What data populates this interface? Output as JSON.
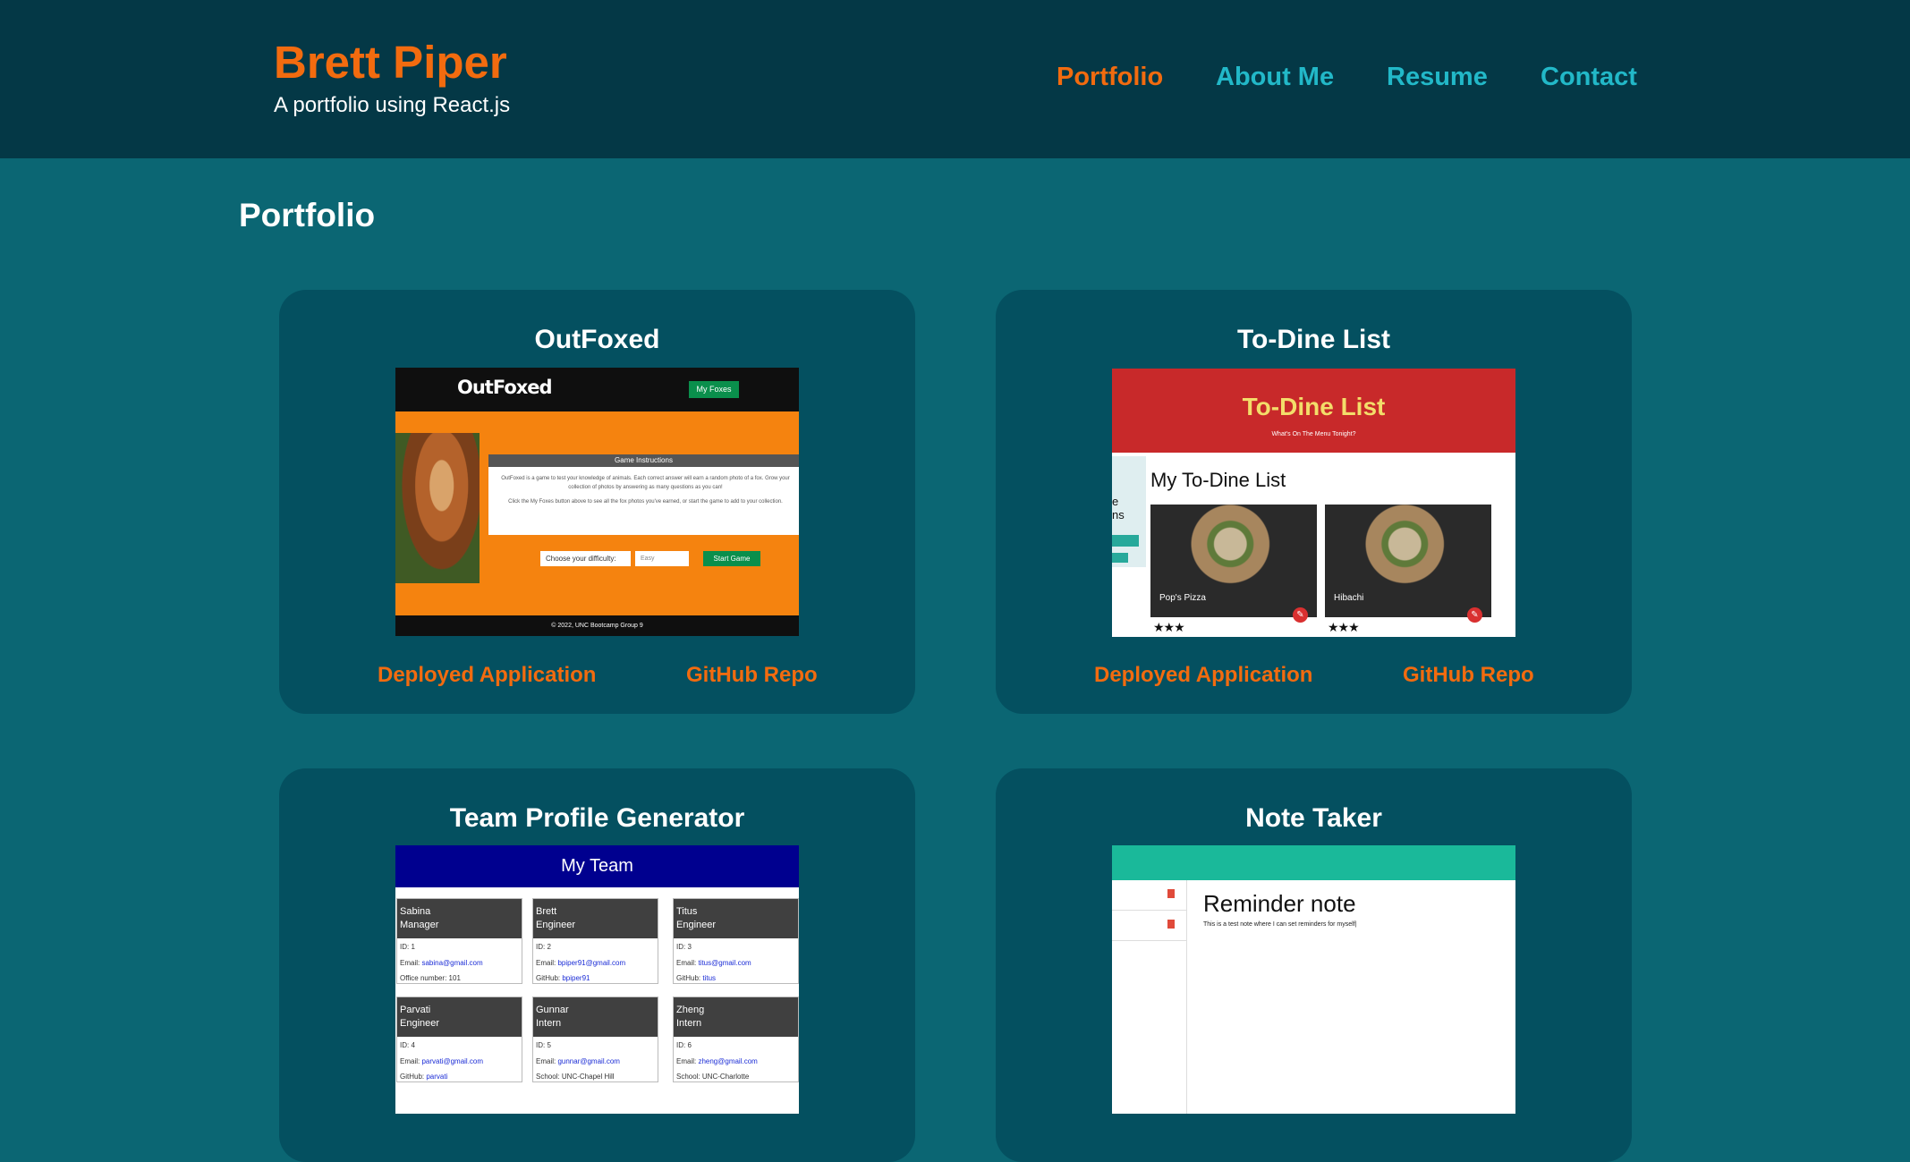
{
  "header": {
    "name": "Brett Piper",
    "tagline": "A portfolio using React.js",
    "nav": [
      {
        "label": "Portfolio",
        "active": true
      },
      {
        "label": "About Me"
      },
      {
        "label": "Resume"
      },
      {
        "label": "Contact"
      }
    ]
  },
  "page": {
    "title": "Portfolio"
  },
  "projects": [
    {
      "title": "OutFoxed",
      "deployed_label": "Deployed Application",
      "repo_label": "GitHub Repo",
      "screenshot": {
        "logo": "OutFoxed",
        "button": "My Foxes",
        "panel_title": "Game Instructions",
        "panel_text_1": "OutFoxed is a game to test your knowledge of animals. Each correct answer will earn a random photo of a fox. Grow your collection of photos by answering as many questions as you can!",
        "panel_text_2": "Click the My Foxes button above to see all the fox photos you've earned, or start the game to add to your collection.",
        "difficulty_label": "Choose your difficulty:",
        "difficulty_value": "Easy",
        "start_button": "Start Game",
        "footer": "© 2022, UNC Bootcamp Group 9"
      }
    },
    {
      "title": "To-Dine List",
      "deployed_label": "Deployed Application",
      "repo_label": "GitHub Repo",
      "screenshot": {
        "logo": "To-Dine List",
        "tagline": "What's On The Menu Tonight?",
        "side_text": "e\nns",
        "heading": "My To-Dine List",
        "cards": [
          {
            "label": "Pop's Pizza",
            "stars": "★★★"
          },
          {
            "label": "Hibachi",
            "stars": "★★★"
          }
        ]
      }
    },
    {
      "title": "Team Profile Generator",
      "screenshot": {
        "header": "My Team",
        "members": [
          {
            "name": "Sabina",
            "role": "Manager",
            "id": "ID: 1",
            "email": "sabina@gmail.com",
            "extra_label": "Office number: ",
            "extra_value": "101"
          },
          {
            "name": "Brett",
            "role": "Engineer",
            "id": "ID: 2",
            "email": "bpiper91@gmail.com",
            "extra_label": "GitHub: ",
            "extra_value": "bpiper91"
          },
          {
            "name": "Titus",
            "role": "Engineer",
            "id": "ID: 3",
            "email": "titus@gmail.com",
            "extra_label": "GitHub: ",
            "extra_value": "titus"
          },
          {
            "name": "Parvati",
            "role": "Engineer",
            "id": "ID: 4",
            "email": "parvati@gmail.com",
            "extra_label": "GitHub: ",
            "extra_value": "parvati"
          },
          {
            "name": "Gunnar",
            "role": "Intern",
            "id": "ID: 5",
            "email": "gunnar@gmail.com",
            "extra_label": "School: ",
            "extra_value": "UNC-Chapel Hill"
          },
          {
            "name": "Zheng",
            "role": "Intern",
            "id": "ID: 6",
            "email": "zheng@gmail.com",
            "extra_label": "School: ",
            "extra_value": "UNC-Charlotte"
          }
        ]
      }
    },
    {
      "title": "Note Taker",
      "screenshot": {
        "note_title": "Reminder note",
        "note_text": "This is a test note where I can set reminders for myself|"
      }
    }
  ],
  "colors": {
    "page_bg": "#0b6673",
    "header_bg": "#043846",
    "card_bg": "#045060",
    "accent": "#f26b0f",
    "nav_link": "#22b8c8"
  }
}
